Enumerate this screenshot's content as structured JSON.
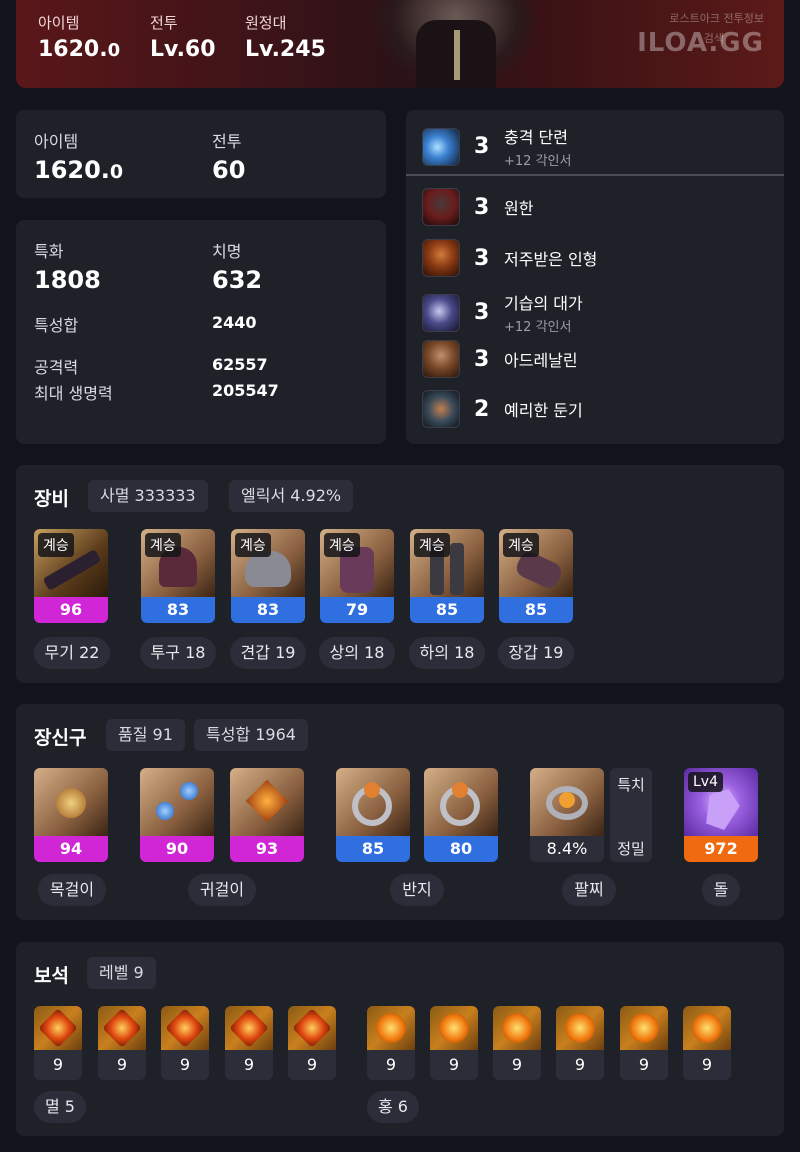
{
  "header": {
    "item_label": "아이템",
    "item_value": "1620.",
    "item_value_small": "0",
    "combat_label": "전투",
    "combat_value": "Lv.60",
    "expedition_label": "원정대",
    "expedition_value": "Lv.245",
    "watermark_top": "로스트아크 전투정보",
    "watermark_brand": "ILOA.GG",
    "watermark_sub": "검색"
  },
  "levels": {
    "item_label": "아이템",
    "item_value": "1620.",
    "item_value_small": "0",
    "combat_label": "전투",
    "combat_value": "60"
  },
  "stats": {
    "special_label": "특화",
    "special_value": "1808",
    "crit_label": "치명",
    "crit_value": "632",
    "total_label": "특성합",
    "total_value": "2440",
    "atk_label": "공격력",
    "atk_value": "62557",
    "hp_label": "최대 생명력",
    "hp_value": "205547"
  },
  "engravings": [
    {
      "level": "3",
      "name": "충격 단련",
      "sub": "+12 각인서",
      "icon": "shock-training-icon",
      "color": "#3a7fd0"
    },
    {
      "level": "3",
      "name": "원한",
      "sub": "",
      "icon": "grudge-icon",
      "color": "#6a1d1d"
    },
    {
      "level": "3",
      "name": "저주받은 인형",
      "sub": "",
      "icon": "cursed-doll-icon",
      "color": "#8a3a14"
    },
    {
      "level": "3",
      "name": "기습의 대가",
      "sub": "+12 각인서",
      "icon": "master-ambush-icon",
      "color": "#4a4a8a"
    },
    {
      "level": "3",
      "name": "아드레날린",
      "sub": "",
      "icon": "adrenaline-icon",
      "color": "#7a4a2a"
    },
    {
      "level": "2",
      "name": "예리한 둔기",
      "sub": "",
      "icon": "keen-blunt-weapon-icon",
      "color": "#3a4a5a"
    }
  ],
  "equipment": {
    "title": "장비",
    "set_chip": "사멸 333333",
    "elixir_chip": "엘릭서 4.92%",
    "items": [
      {
        "tag": "계승",
        "quality": "96",
        "label": "무기 22",
        "bar": "#d026d6",
        "icon": "weapon-icon"
      },
      {
        "tag": "계승",
        "quality": "83",
        "label": "투구 18",
        "bar": "#2f6fe0",
        "icon": "helmet-icon"
      },
      {
        "tag": "계승",
        "quality": "83",
        "label": "견갑 19",
        "bar": "#2f6fe0",
        "icon": "shoulder-icon"
      },
      {
        "tag": "계승",
        "quality": "79",
        "label": "상의 18",
        "bar": "#2f6fe0",
        "icon": "chest-icon"
      },
      {
        "tag": "계승",
        "quality": "85",
        "label": "하의 18",
        "bar": "#2f6fe0",
        "icon": "pants-icon"
      },
      {
        "tag": "계승",
        "quality": "85",
        "label": "장갑 19",
        "bar": "#2f6fe0",
        "icon": "gloves-icon"
      }
    ]
  },
  "accessories": {
    "title": "장신구",
    "quality_chip": "품질 91",
    "total_chip": "특성합 1964",
    "items": [
      {
        "quality": "94",
        "bar": "#d026d6",
        "icon": "necklace-icon"
      },
      {
        "quality": "90",
        "bar": "#d026d6",
        "icon": "earring-icon"
      },
      {
        "quality": "93",
        "bar": "#d026d6",
        "icon": "earring-icon"
      },
      {
        "quality": "85",
        "bar": "#2f6fe0",
        "icon": "ring-icon"
      },
      {
        "quality": "80",
        "bar": "#2f6fe0",
        "icon": "ring-icon"
      }
    ],
    "bracelet": {
      "value": "8.4%",
      "stat1": "특치",
      "stat2": "정밀",
      "icon": "bracelet-icon"
    },
    "stone": {
      "tag": "Lv4",
      "value": "972",
      "bar": "#f06a10",
      "icon": "ability-stone-icon"
    },
    "labels": {
      "necklace": "목걸이",
      "earring": "귀걸이",
      "ring": "반지",
      "bracelet": "팔찌",
      "stone": "돌"
    }
  },
  "gems": {
    "title": "보석",
    "level_chip": "레벨 9",
    "annihilation": {
      "label": "멸 5",
      "levels": [
        "9",
        "9",
        "9",
        "9",
        "9"
      ]
    },
    "crimson": {
      "label": "홍 6",
      "levels": [
        "9",
        "9",
        "9",
        "9",
        "9",
        "9"
      ]
    }
  }
}
